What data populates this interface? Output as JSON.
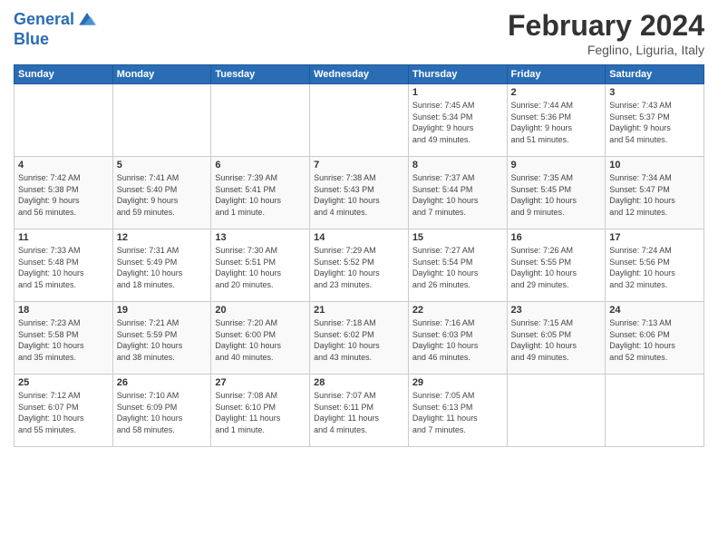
{
  "logo": {
    "line1": "General",
    "line2": "Blue"
  },
  "header": {
    "title": "February 2024",
    "location": "Feglino, Liguria, Italy"
  },
  "weekdays": [
    "Sunday",
    "Monday",
    "Tuesday",
    "Wednesday",
    "Thursday",
    "Friday",
    "Saturday"
  ],
  "weeks": [
    [
      {
        "day": "",
        "info": ""
      },
      {
        "day": "",
        "info": ""
      },
      {
        "day": "",
        "info": ""
      },
      {
        "day": "",
        "info": ""
      },
      {
        "day": "1",
        "info": "Sunrise: 7:45 AM\nSunset: 5:34 PM\nDaylight: 9 hours\nand 49 minutes."
      },
      {
        "day": "2",
        "info": "Sunrise: 7:44 AM\nSunset: 5:36 PM\nDaylight: 9 hours\nand 51 minutes."
      },
      {
        "day": "3",
        "info": "Sunrise: 7:43 AM\nSunset: 5:37 PM\nDaylight: 9 hours\nand 54 minutes."
      }
    ],
    [
      {
        "day": "4",
        "info": "Sunrise: 7:42 AM\nSunset: 5:38 PM\nDaylight: 9 hours\nand 56 minutes."
      },
      {
        "day": "5",
        "info": "Sunrise: 7:41 AM\nSunset: 5:40 PM\nDaylight: 9 hours\nand 59 minutes."
      },
      {
        "day": "6",
        "info": "Sunrise: 7:39 AM\nSunset: 5:41 PM\nDaylight: 10 hours\nand 1 minute."
      },
      {
        "day": "7",
        "info": "Sunrise: 7:38 AM\nSunset: 5:43 PM\nDaylight: 10 hours\nand 4 minutes."
      },
      {
        "day": "8",
        "info": "Sunrise: 7:37 AM\nSunset: 5:44 PM\nDaylight: 10 hours\nand 7 minutes."
      },
      {
        "day": "9",
        "info": "Sunrise: 7:35 AM\nSunset: 5:45 PM\nDaylight: 10 hours\nand 9 minutes."
      },
      {
        "day": "10",
        "info": "Sunrise: 7:34 AM\nSunset: 5:47 PM\nDaylight: 10 hours\nand 12 minutes."
      }
    ],
    [
      {
        "day": "11",
        "info": "Sunrise: 7:33 AM\nSunset: 5:48 PM\nDaylight: 10 hours\nand 15 minutes."
      },
      {
        "day": "12",
        "info": "Sunrise: 7:31 AM\nSunset: 5:49 PM\nDaylight: 10 hours\nand 18 minutes."
      },
      {
        "day": "13",
        "info": "Sunrise: 7:30 AM\nSunset: 5:51 PM\nDaylight: 10 hours\nand 20 minutes."
      },
      {
        "day": "14",
        "info": "Sunrise: 7:29 AM\nSunset: 5:52 PM\nDaylight: 10 hours\nand 23 minutes."
      },
      {
        "day": "15",
        "info": "Sunrise: 7:27 AM\nSunset: 5:54 PM\nDaylight: 10 hours\nand 26 minutes."
      },
      {
        "day": "16",
        "info": "Sunrise: 7:26 AM\nSunset: 5:55 PM\nDaylight: 10 hours\nand 29 minutes."
      },
      {
        "day": "17",
        "info": "Sunrise: 7:24 AM\nSunset: 5:56 PM\nDaylight: 10 hours\nand 32 minutes."
      }
    ],
    [
      {
        "day": "18",
        "info": "Sunrise: 7:23 AM\nSunset: 5:58 PM\nDaylight: 10 hours\nand 35 minutes."
      },
      {
        "day": "19",
        "info": "Sunrise: 7:21 AM\nSunset: 5:59 PM\nDaylight: 10 hours\nand 38 minutes."
      },
      {
        "day": "20",
        "info": "Sunrise: 7:20 AM\nSunset: 6:00 PM\nDaylight: 10 hours\nand 40 minutes."
      },
      {
        "day": "21",
        "info": "Sunrise: 7:18 AM\nSunset: 6:02 PM\nDaylight: 10 hours\nand 43 minutes."
      },
      {
        "day": "22",
        "info": "Sunrise: 7:16 AM\nSunset: 6:03 PM\nDaylight: 10 hours\nand 46 minutes."
      },
      {
        "day": "23",
        "info": "Sunrise: 7:15 AM\nSunset: 6:05 PM\nDaylight: 10 hours\nand 49 minutes."
      },
      {
        "day": "24",
        "info": "Sunrise: 7:13 AM\nSunset: 6:06 PM\nDaylight: 10 hours\nand 52 minutes."
      }
    ],
    [
      {
        "day": "25",
        "info": "Sunrise: 7:12 AM\nSunset: 6:07 PM\nDaylight: 10 hours\nand 55 minutes."
      },
      {
        "day": "26",
        "info": "Sunrise: 7:10 AM\nSunset: 6:09 PM\nDaylight: 10 hours\nand 58 minutes."
      },
      {
        "day": "27",
        "info": "Sunrise: 7:08 AM\nSunset: 6:10 PM\nDaylight: 11 hours\nand 1 minute."
      },
      {
        "day": "28",
        "info": "Sunrise: 7:07 AM\nSunset: 6:11 PM\nDaylight: 11 hours\nand 4 minutes."
      },
      {
        "day": "29",
        "info": "Sunrise: 7:05 AM\nSunset: 6:13 PM\nDaylight: 11 hours\nand 7 minutes."
      },
      {
        "day": "",
        "info": ""
      },
      {
        "day": "",
        "info": ""
      }
    ]
  ]
}
